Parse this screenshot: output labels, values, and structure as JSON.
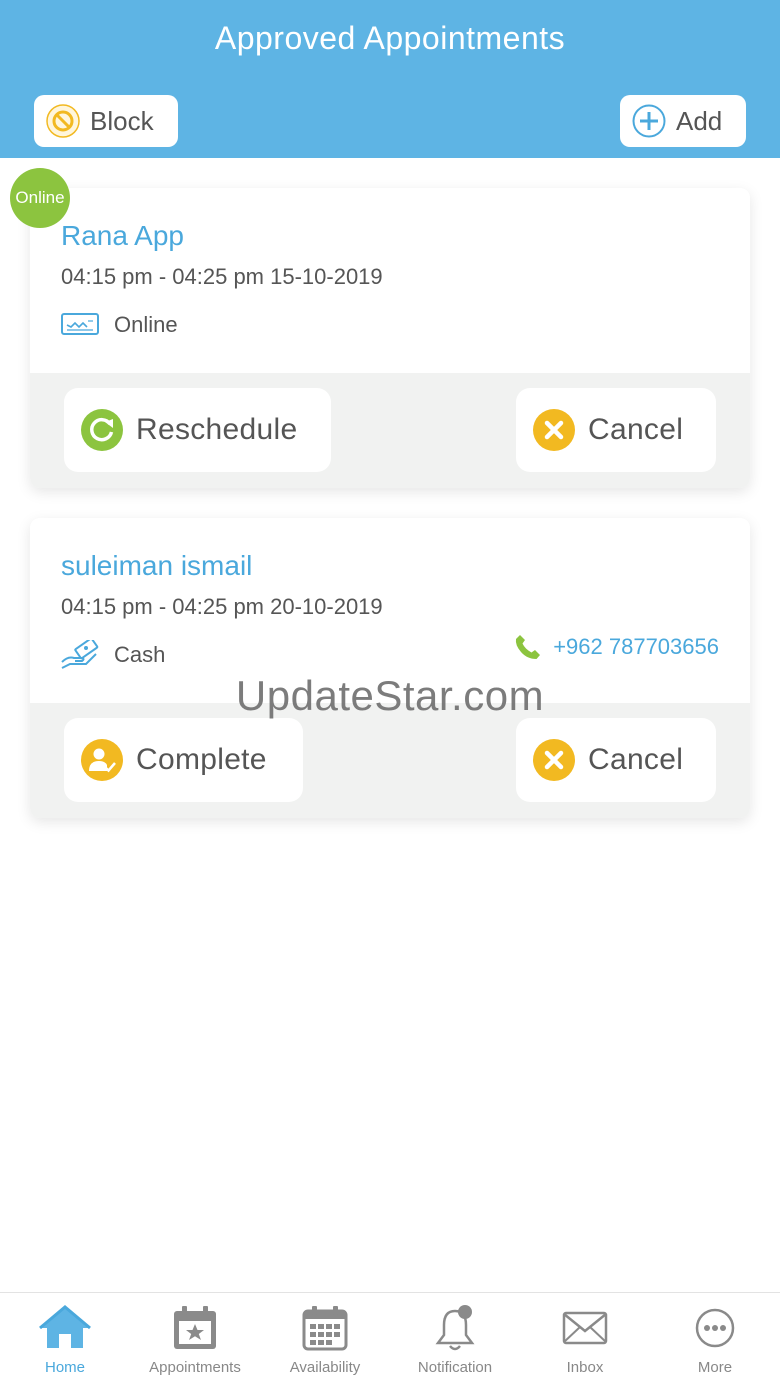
{
  "header": {
    "title": "Approved Appointments",
    "block_label": "Block",
    "add_label": "Add"
  },
  "appointments": [
    {
      "badge": "Online",
      "name": "Rana App",
      "time": "04:15 pm - 04:25 pm 15-10-2019",
      "payment_method": "Online",
      "payment_icon": "cheque-icon",
      "phone": "",
      "primary_action": "Reschedule",
      "secondary_action": "Cancel"
    },
    {
      "name": "suleiman ismail",
      "time": "04:15 pm - 04:25 pm 20-10-2019",
      "payment_method": "Cash",
      "payment_icon": "cash-hand-icon",
      "phone": "+962 787703656",
      "primary_action": "Complete",
      "secondary_action": "Cancel"
    }
  ],
  "watermark": "UpdateStar.com",
  "tabbar": {
    "active": "Home",
    "items": [
      {
        "label": "Home",
        "icon": "home-icon"
      },
      {
        "label": "Appointments",
        "icon": "calendar-star-icon"
      },
      {
        "label": "Availability",
        "icon": "calendar-grid-icon"
      },
      {
        "label": "Notification",
        "icon": "bell-icon"
      },
      {
        "label": "Inbox",
        "icon": "envelope-icon"
      },
      {
        "label": "More",
        "icon": "more-dots-icon"
      }
    ]
  },
  "colors": {
    "header_bg": "#5eb4e4",
    "accent_blue": "#4aa8dc",
    "green": "#8cc43f",
    "amber": "#f2b921",
    "action_bg": "#f1f2f1",
    "tab_icon_gray": "#8a8a8a"
  }
}
